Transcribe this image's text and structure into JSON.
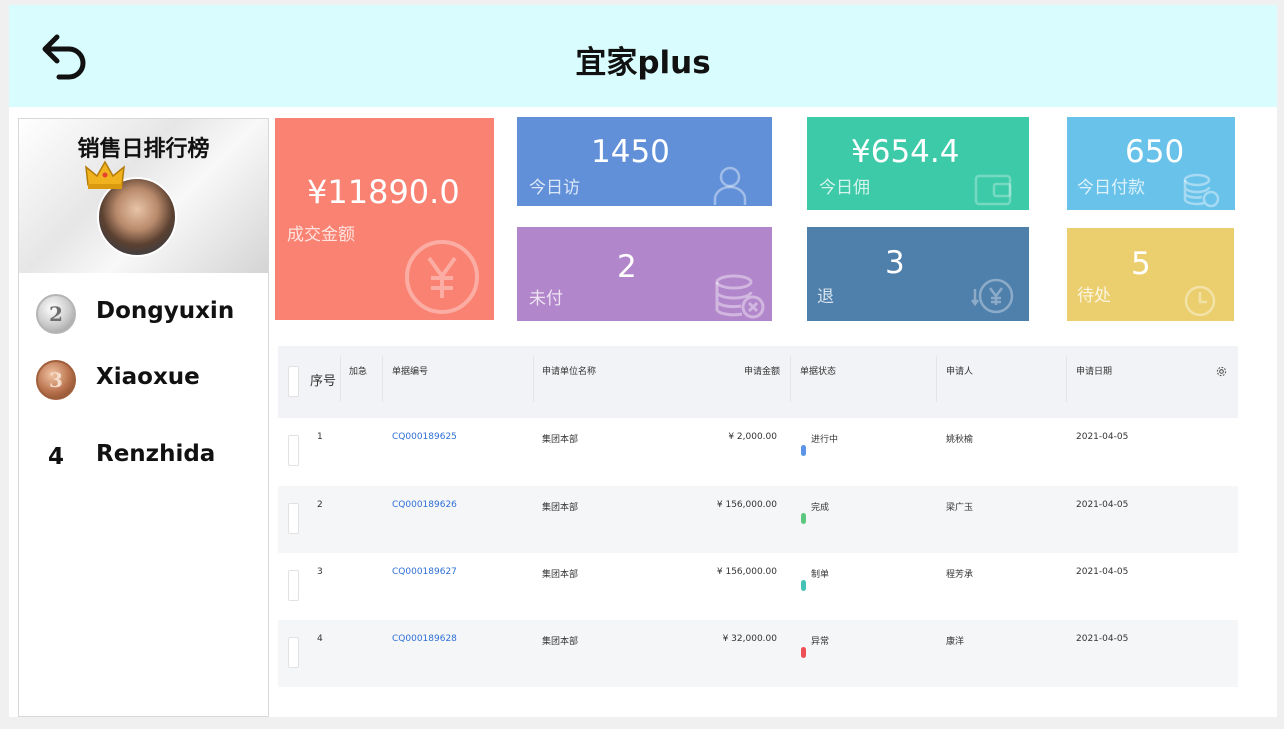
{
  "header": {
    "title": "宜家plus",
    "back_icon": "back-arrow-icon"
  },
  "ranking": {
    "title": "销售日排行榜",
    "items": [
      {
        "rank": "2",
        "name": "Dongyuxin",
        "medal": "silver"
      },
      {
        "rank": "3",
        "name": "Xiaoxue",
        "medal": "bronze"
      },
      {
        "rank": "4",
        "name": "Renzhida",
        "medal": "none"
      }
    ]
  },
  "stats": {
    "deal_amount": {
      "value": "¥11890.0",
      "label": "成交金额",
      "color": "#fa8272"
    },
    "today_visits": {
      "value": "1450",
      "label": "今日访",
      "color": "#6190d9"
    },
    "today_commission": {
      "value": "¥654.4",
      "label": "今日佣",
      "color": "#3ccaa8"
    },
    "today_payment": {
      "value": "650",
      "label": "今日付款",
      "color": "#69c2ea"
    },
    "unpaid": {
      "value": "2",
      "label": "未付",
      "color": "#b286cb"
    },
    "refund": {
      "value": "3",
      "label": "退",
      "color": "#4f7fab"
    },
    "pending": {
      "value": "5",
      "label": "待处",
      "color": "#ebcf6e"
    }
  },
  "table": {
    "headers": {
      "seq": "序号",
      "urgent": "加急",
      "doc_no": "单据编号",
      "unit": "申请单位名称",
      "amount": "申请金额",
      "status": "单据状态",
      "applicant": "申请人",
      "date": "申请日期"
    },
    "rows": [
      {
        "seq": "1",
        "doc_no": "CQ000189625",
        "unit": "集团本部",
        "amount": "¥ 2,000.00",
        "status": "进行中",
        "status_color": "#5b93e8",
        "applicant": "姚秋榆",
        "date": "2021-04-05"
      },
      {
        "seq": "2",
        "doc_no": "CQ000189626",
        "unit": "集团本部",
        "amount": "¥ 156,000.00",
        "status": "完成",
        "status_color": "#5cc77f",
        "applicant": "梁广玉",
        "date": "2021-04-05"
      },
      {
        "seq": "3",
        "doc_no": "CQ000189627",
        "unit": "集团本部",
        "amount": "¥ 156,000.00",
        "status": "制单",
        "status_color": "#45c2b8",
        "applicant": "程芳承",
        "date": "2021-04-05"
      },
      {
        "seq": "4",
        "doc_no": "CQ000189628",
        "unit": "集团本部",
        "amount": "¥ 32,000.00",
        "status": "异常",
        "status_color": "#ee4e55",
        "applicant": "康洋",
        "date": "2021-04-05"
      }
    ]
  }
}
